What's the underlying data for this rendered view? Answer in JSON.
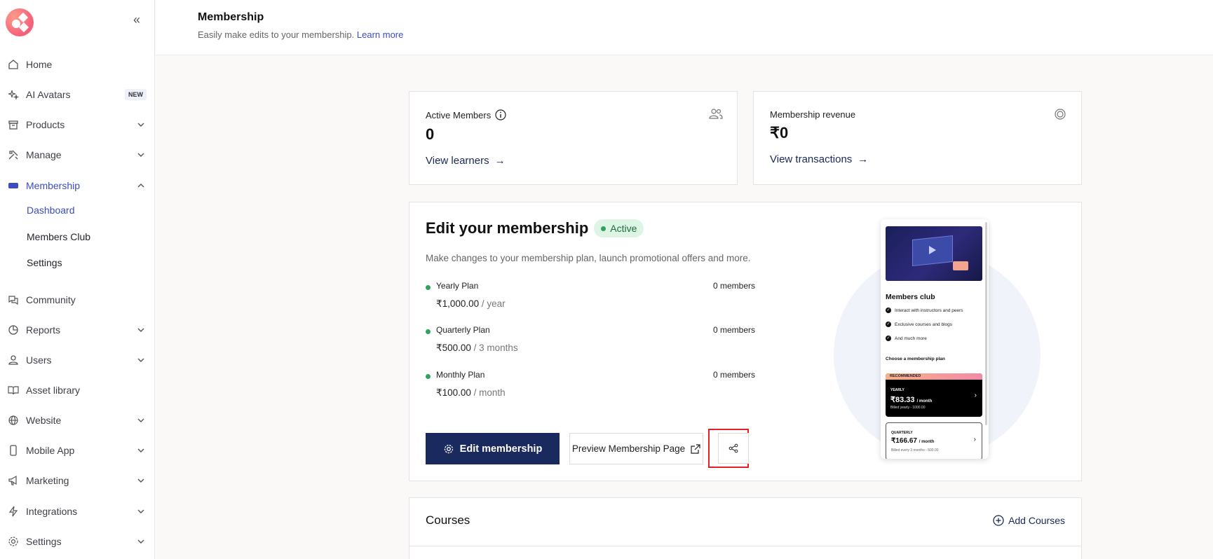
{
  "sidebar": {
    "collapse_icon": "double-chevron-left-icon",
    "items": [
      {
        "label": "Home",
        "icon": "home-icon"
      },
      {
        "label": "AI Avatars",
        "icon": "sparkle-icon",
        "badge": "NEW"
      },
      {
        "label": "Products",
        "icon": "archive-icon"
      },
      {
        "label": "Manage",
        "icon": "tools-icon"
      },
      {
        "label": "Membership",
        "icon": "membership-icon"
      },
      {
        "label": "Community",
        "icon": "chat-icon"
      },
      {
        "label": "Reports",
        "icon": "pie-chart-icon"
      },
      {
        "label": "Users",
        "icon": "user-icon"
      },
      {
        "label": "Asset library",
        "icon": "book-icon"
      },
      {
        "label": "Website",
        "icon": "globe-icon"
      },
      {
        "label": "Mobile App",
        "icon": "mobile-icon"
      },
      {
        "label": "Marketing",
        "icon": "megaphone-icon"
      },
      {
        "label": "Integrations",
        "icon": "bolt-icon"
      },
      {
        "label": "Settings",
        "icon": "gear-icon"
      }
    ],
    "membership_sub": [
      "Dashboard",
      "Members Club",
      "Settings"
    ]
  },
  "header": {
    "title": "Membership",
    "subtitle": "Easily make edits to your membership.",
    "learn_more": "Learn more"
  },
  "stats": {
    "active_members": {
      "title": "Active Members",
      "value": "0",
      "link": "View learners"
    },
    "revenue": {
      "title": "Membership revenue",
      "value": "₹0",
      "link": "View transactions"
    }
  },
  "edit": {
    "title": "Edit your membership",
    "status": "Active",
    "description": "Make changes to your membership plan, launch promotional offers and more.",
    "plans": [
      {
        "name": "Yearly Plan",
        "members": "0 members",
        "price": "₹1,000.00",
        "period": "/ year"
      },
      {
        "name": "Quarterly Plan",
        "members": "0 members",
        "price": "₹500.00",
        "period": "/ 3 months"
      },
      {
        "name": "Monthly Plan",
        "members": "0 members",
        "price": "₹100.00",
        "period": "/ month"
      }
    ],
    "edit_button": "Edit membership",
    "preview_button": "Preview Membership Page"
  },
  "preview": {
    "title": "Members club",
    "features": [
      "Interact with instructors and peers",
      "Exclusive courses and blogs",
      "And much more"
    ],
    "choose": "Choose a membership plan",
    "recommended_tag": "RECOMMENDED",
    "yearly_label": "YEARLY",
    "yearly_price": "₹83.33",
    "yearly_unit": "/ month",
    "yearly_sub": "Billed yearly - 1000.00",
    "quarterly_label": "QUARTERLY",
    "quarterly_price": "₹166.67",
    "quarterly_unit": "/ month",
    "quarterly_sub": "Billed every 3 months - 500.00"
  },
  "courses": {
    "title": "Courses",
    "add": "Add Courses"
  }
}
